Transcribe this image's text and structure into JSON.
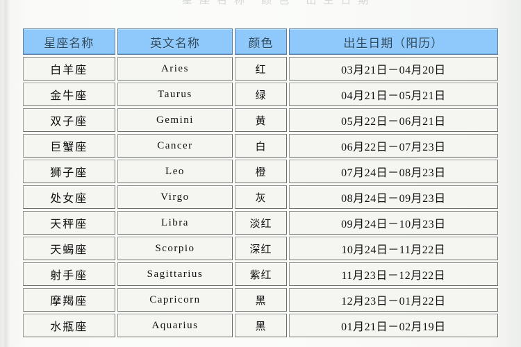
{
  "page": {
    "top_clipped_text": "星座名称  颜色  出生日期"
  },
  "table": {
    "headers": {
      "name": "星座名称",
      "english": "英文名称",
      "color": "颜色",
      "birthdate": "出生日期（阳历）"
    },
    "header_color": "#8ec5f5",
    "rows": [
      {
        "name": "白羊座",
        "english": "Aries",
        "color": "红",
        "birthdate": "03月21日－04月20日"
      },
      {
        "name": "金牛座",
        "english": "Taurus",
        "color": "绿",
        "birthdate": "04月21日－05月21日"
      },
      {
        "name": "双子座",
        "english": "Gemini",
        "color": "黄",
        "birthdate": "05月22日－06月21日"
      },
      {
        "name": "巨蟹座",
        "english": "Cancer",
        "color": "白",
        "birthdate": "06月22日－07月23日"
      },
      {
        "name": "狮子座",
        "english": "Leo",
        "color": "橙",
        "birthdate": "07月24日－08月23日"
      },
      {
        "name": "处女座",
        "english": "Virgo",
        "color": "灰",
        "birthdate": "08月24日－09月23日"
      },
      {
        "name": "天秤座",
        "english": "Libra",
        "color": "淡红",
        "birthdate": "09月24日－10月23日"
      },
      {
        "name": "天蝎座",
        "english": "Scorpio",
        "color": "深红",
        "birthdate": "10月24日－11月22日"
      },
      {
        "name": "射手座",
        "english": "Sagittarius",
        "color": "紫红",
        "birthdate": "11月23日－12月22日"
      },
      {
        "name": "摩羯座",
        "english": "Capricorn",
        "color": "黑",
        "birthdate": "12月23日－01月22日"
      },
      {
        "name": "水瓶座",
        "english": "Aquarius",
        "color": "黑",
        "birthdate": "01月21日－02月19日"
      }
    ]
  }
}
